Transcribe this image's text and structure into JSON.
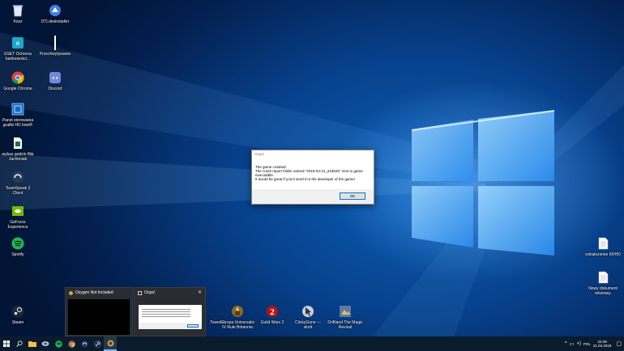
{
  "desktop": {
    "icons": [
      {
        "label": "Kosz",
        "icon": "recycle-bin-icon"
      },
      {
        "label": "DTLdesinstaller",
        "icon": "installer-icon"
      },
      {
        "label": "ESET Ochrona\nbankowości...",
        "icon": "eset-icon"
      },
      {
        "label": "Przechwytywanie",
        "icon": "capture-icon"
      },
      {
        "label": "Google Chrome",
        "icon": "chrome-icon"
      },
      {
        "label": "Discord",
        "icon": "discord-icon"
      },
      {
        "label": "Panel sterowania\ngrafiki HD Intel®",
        "icon": "intel-graphics-icon"
      },
      {
        "label": "wykaz godzin filip\nJachimiak",
        "icon": "document-icon"
      },
      {
        "label": "TeamSpeak 3 Client",
        "icon": "teamspeak-icon"
      },
      {
        "label": "GeForce Experience",
        "icon": "geforce-icon"
      },
      {
        "label": "Spotify",
        "icon": "spotify-icon"
      },
      {
        "label": "Steam",
        "icon": "steam-icon"
      },
      {
        "label": "Tower Z",
        "icon": "game-icon"
      },
      {
        "label": "Europa Universalis\nIV Rule Britannia",
        "icon": "europa-universalis-icon"
      },
      {
        "label": "Guild Wars 2",
        "icon": "guild-wars-icon"
      },
      {
        "label": "ClickyGone — skrót",
        "icon": "clickygone-icon"
      },
      {
        "label": "Driftland The Magic\nRevival",
        "icon": "driftland-icon"
      },
      {
        "label": "odnalezienie KRHD",
        "icon": "text-file-icon"
      },
      {
        "label": "Nowy dokument\ntekstowy",
        "icon": "text-file-icon"
      }
    ]
  },
  "dialog": {
    "title": "Oops!",
    "line1": "The game crashed.",
    "line2": "The crash report folder named \"2018-04-21_223626\" next to game",
    "line3": "executable.",
    "line4": "It would be great if you'd send it to the developer of the game!",
    "ok_label": "OK"
  },
  "thumbnails": {
    "oni": {
      "title": "Oxygen Not Included"
    },
    "oops": {
      "title": "Oops!",
      "close": "✕"
    }
  },
  "taskbar": {
    "clock_time": "22:39",
    "clock_date": "21.04.2018",
    "language": "POL"
  }
}
